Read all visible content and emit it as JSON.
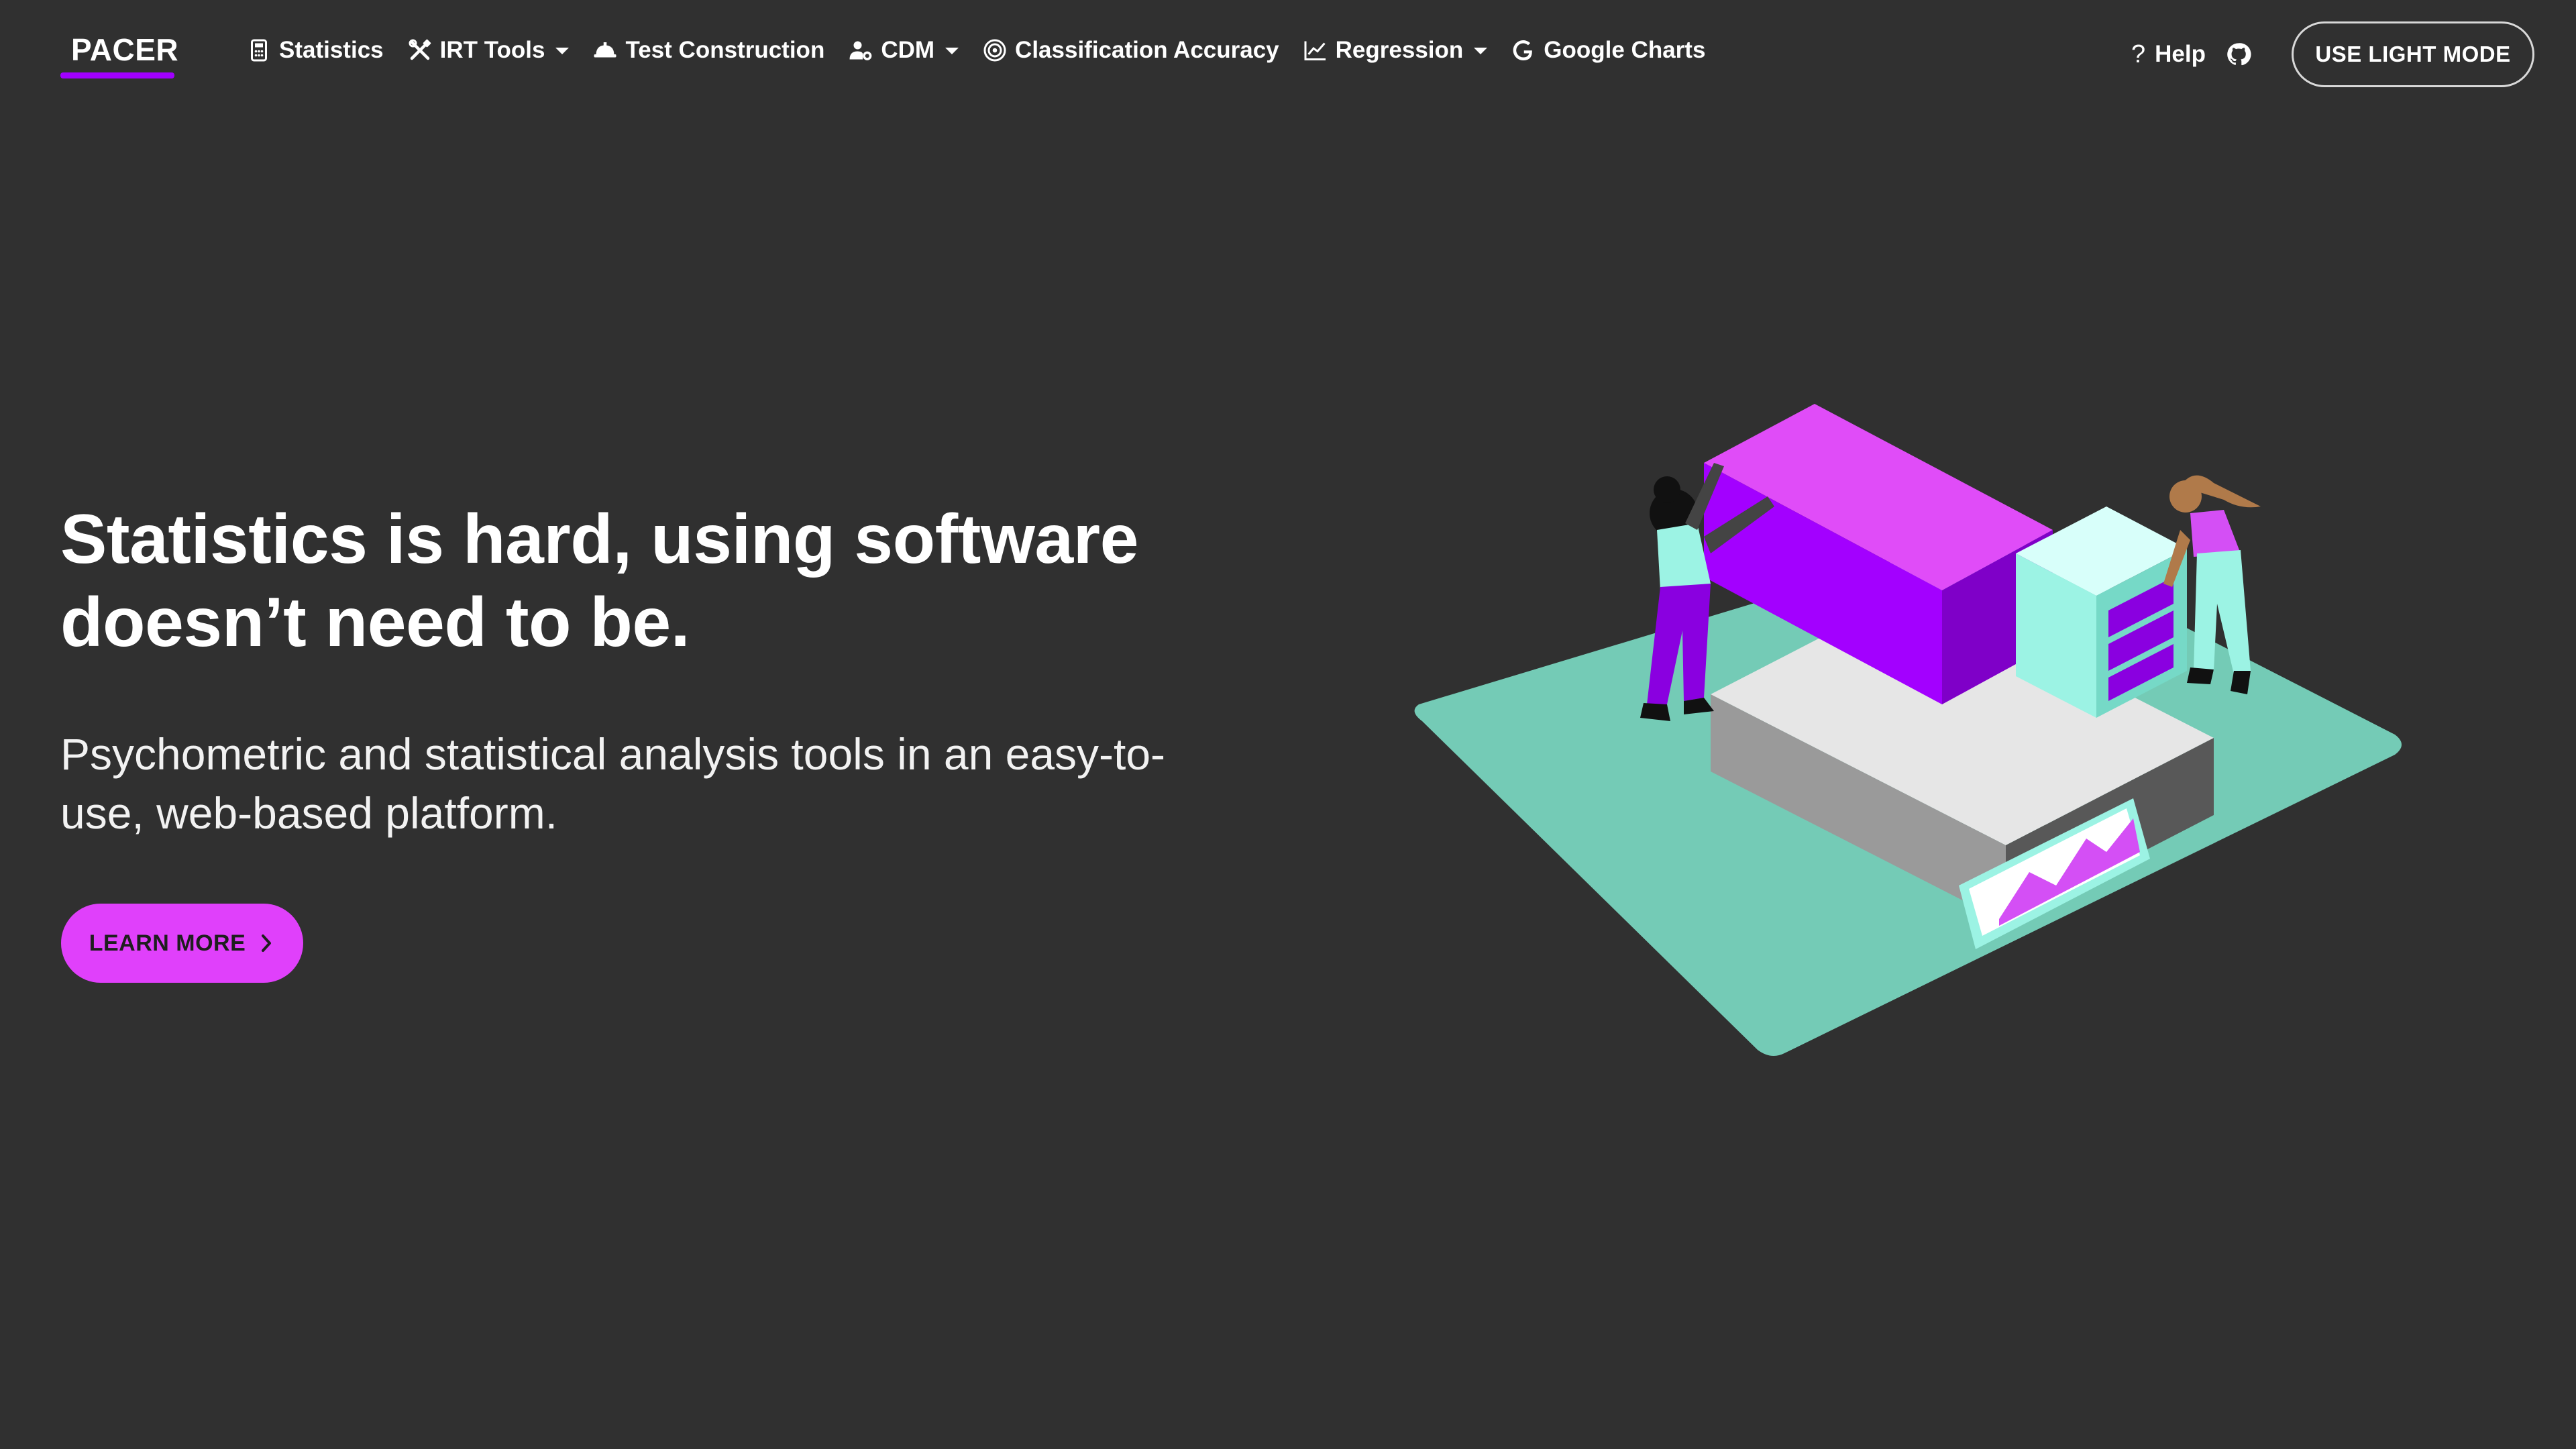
{
  "brand": {
    "name": "PACER",
    "accent": "#a100ff"
  },
  "nav": {
    "items": [
      {
        "label": "Statistics",
        "icon": "calculator-icon",
        "dropdown": false
      },
      {
        "label": "IRT Tools",
        "icon": "tools-icon",
        "dropdown": true
      },
      {
        "label": "Test Construction",
        "icon": "hard-hat-icon",
        "dropdown": false
      },
      {
        "label": "CDM",
        "icon": "user-cog-icon",
        "dropdown": true
      },
      {
        "label": "Classification Accuracy",
        "icon": "bullseye-icon",
        "dropdown": false
      },
      {
        "label": "Regression",
        "icon": "line-chart-icon",
        "dropdown": true
      },
      {
        "label": "Google Charts",
        "icon": "google-icon",
        "dropdown": false
      }
    ],
    "help_label": "Help",
    "github_icon": "github-icon",
    "mode_button_label": "USE LIGHT MODE"
  },
  "hero": {
    "title_line1": "Statistics is hard, using software",
    "title_line2": "doesn’t need to be.",
    "subtitle": "Psychometric and statistical analysis tools in an easy-to-use, web-based platform.",
    "cta_label": "LEARN MORE",
    "cta_color": "#e040fb"
  },
  "colors": {
    "background": "#303030",
    "illustration_magenta": "#d44ff5",
    "illustration_purple": "#8a00e0",
    "illustration_mint": "#9cf3e4",
    "illustration_teal": "#74cbb6"
  }
}
